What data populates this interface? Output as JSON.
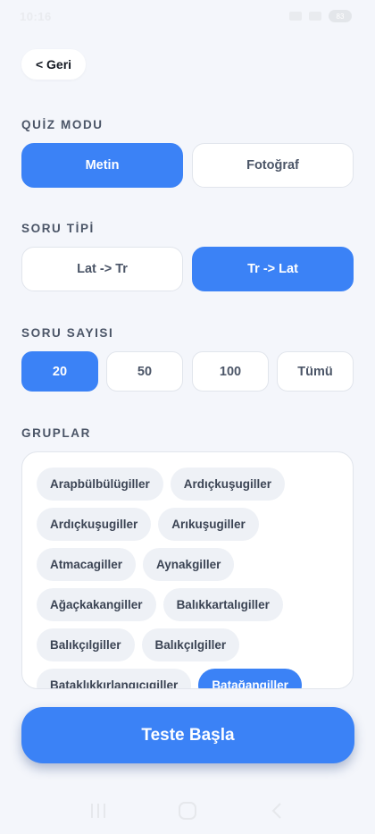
{
  "status_bar": {
    "time": "10:16 ",
    "battery": "83"
  },
  "header": {
    "back_label": "< Geri"
  },
  "quiz_mode": {
    "title": "QUİZ MODU",
    "options": [
      "Metin",
      "Fotoğraf"
    ],
    "selected": "Metin"
  },
  "question_type": {
    "title": "SORU TİPİ",
    "options": [
      "Lat -> Tr",
      "Tr -> Lat"
    ],
    "selected": "Tr -> Lat"
  },
  "question_count": {
    "title": "SORU SAYISI",
    "options": [
      "20",
      "50",
      "100",
      "Tümü"
    ],
    "selected": "20"
  },
  "groups": {
    "title": "GRUPLAR",
    "items": [
      {
        "label": "Arapbülbülügiller",
        "selected": false
      },
      {
        "label": "Ardıçkuşugiller",
        "selected": false
      },
      {
        "label": "Ardıçkuşugiller",
        "selected": false
      },
      {
        "label": "Arıkuşugiller",
        "selected": false
      },
      {
        "label": "Atmacagiller",
        "selected": false
      },
      {
        "label": "Aynakgiller",
        "selected": false
      },
      {
        "label": "Ağaçkakangiller",
        "selected": false
      },
      {
        "label": "Balıkkartalıgiller",
        "selected": false
      },
      {
        "label": "Balıkçılgiller",
        "selected": false
      },
      {
        "label": "Balıkçılgiller",
        "selected": false
      },
      {
        "label": "Bataklıkkırlangıcıgiller",
        "selected": false
      },
      {
        "label": "Batağangiller",
        "selected": true
      }
    ]
  },
  "start": {
    "label": "Teste Başla"
  },
  "colors": {
    "accent": "#3b82f6",
    "background": "#f4f6fb",
    "text": "#4b5567"
  }
}
